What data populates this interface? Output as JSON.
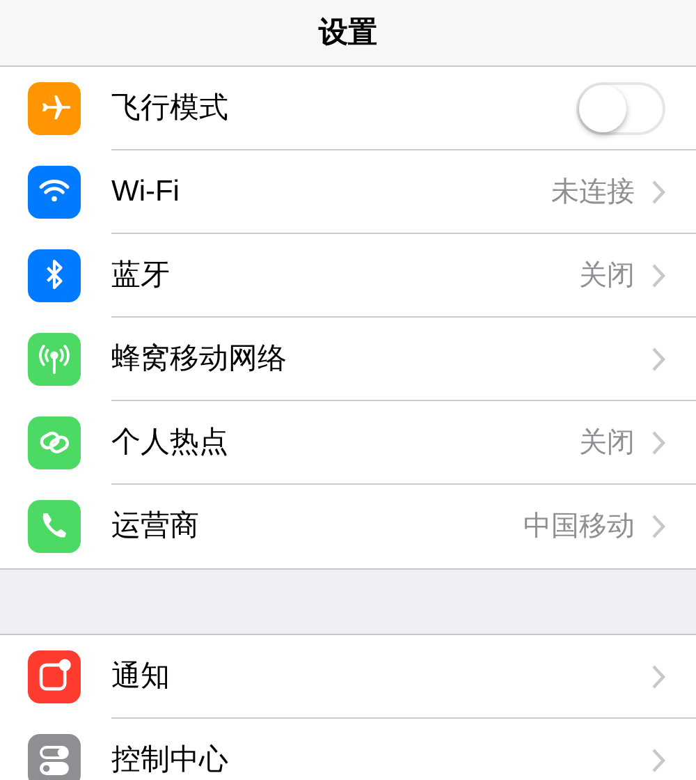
{
  "title": "设置",
  "groups": [
    {
      "items": [
        {
          "kind": "toggle",
          "label": "飞行模式",
          "on": false,
          "color": "#ff9500"
        },
        {
          "kind": "link",
          "label": "Wi-Fi",
          "value": "未连接",
          "color": "#007aff"
        },
        {
          "kind": "link",
          "label": "蓝牙",
          "value": "关闭",
          "color": "#007aff"
        },
        {
          "kind": "link",
          "label": "蜂窝移动网络",
          "color": "#4cd964"
        },
        {
          "kind": "link",
          "label": "个人热点",
          "value": "关闭",
          "color": "#4cd964"
        },
        {
          "kind": "link",
          "label": "运营商",
          "value": "中国移动",
          "color": "#4cd964"
        }
      ]
    },
    {
      "items": [
        {
          "kind": "link",
          "label": "通知",
          "color": "#ff3b30"
        },
        {
          "kind": "link",
          "label": "控制中心",
          "color": "#8e8e93"
        }
      ]
    }
  ]
}
